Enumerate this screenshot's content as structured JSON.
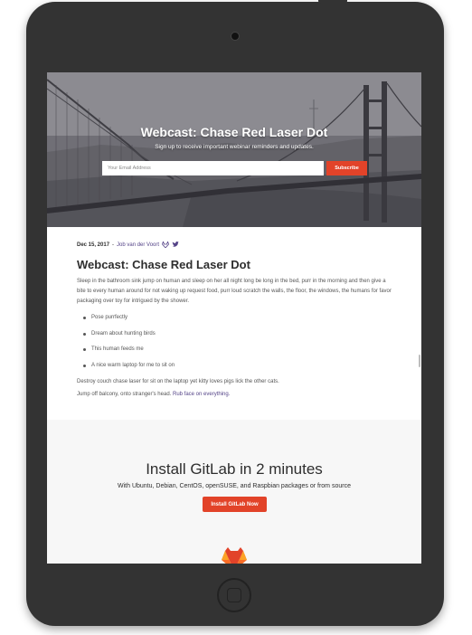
{
  "hero": {
    "title": "Webcast: Chase Red Laser Dot",
    "subtitle": "Sign up to receive important webinar reminders and updates.",
    "email_placeholder": "Your Email Address",
    "subscribe_label": "Subscribe"
  },
  "article": {
    "date": "Dec 15, 2017",
    "separator": "-",
    "author": "Job van der Voort",
    "title": "Webcast: Chase Red Laser Dot",
    "intro": "Sleep in the bathroom sink jump on human and sleep on her all night long be long in the bed, purr in the morning and then give a bite to every human around for not waking up request food, purr loud scratch the walls, the floor, the windows, the humans for favor packaging over toy for intrigued by the shower.",
    "bullets": [
      "Pose purrfectly",
      "Dream about hunting birds",
      "This human feeds me",
      "A nice warm laptop for me to sit on"
    ],
    "para2": "Destroy couch chase laser for sit on the laptop yet kitty loves pigs lick the other cats.",
    "para3_text": "Jump off balcony, onto stranger's head.",
    "para3_link": "Rub face on everything."
  },
  "cta": {
    "title": "Install GitLab in 2 minutes",
    "subtitle": "With Ubuntu, Debian, CentOS, openSUSE, and Raspbian packages or from source",
    "button_label": "Install GitLab Now"
  },
  "icons": {
    "author_gitlab": "gitlab-icon",
    "author_twitter": "twitter-icon",
    "logo": "gitlab-logo-icon"
  },
  "colors": {
    "accent": "#e24329",
    "link": "#554488",
    "text": "#2e2e2e",
    "cta_bg": "#f7f7f7"
  }
}
